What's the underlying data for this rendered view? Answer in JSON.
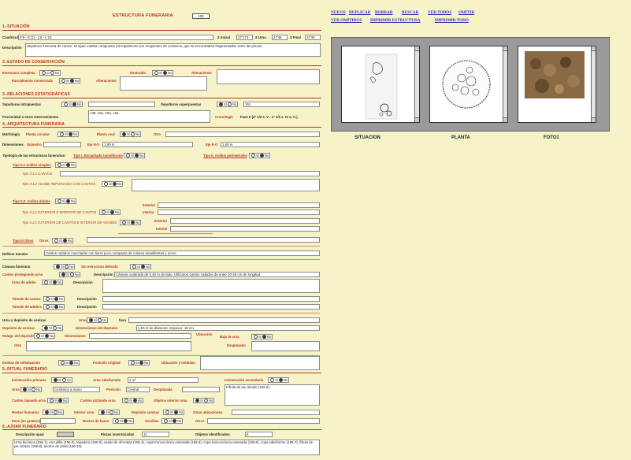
{
  "title": "ESTRUCTURA FUNERARIA",
  "record_id": "100",
  "links": [
    "NUEVO",
    "DUPLICAR",
    "BORRAR",
    "BUSCAR",
    "VER TODOS",
    "OMITIR",
    "VER OMITIDOS",
    "IMPRIMIR ESTRUCTURA",
    "IMPRIMIR TODO"
  ],
  "captions": {
    "situacion": "SITUACION",
    "planta": "PLANTA",
    "foto": "FOTO1"
  },
  "s1": {
    "head": "1.-SITUACIÓN",
    "cuadricula_l": "Cuadrícula",
    "cuadricula_v": "K'8 - K'10 - L'8 - L'10",
    "zi_l": "Z inicial",
    "zi_v": "27'173",
    "zu_l": "Z Urna",
    "zu_v": "27'49",
    "zf_l": "Z Final",
    "zf_v": "27'30",
    "desc_l": "Descripción",
    "desc_v": "Sepultura\nfuneraria de cantos. El ajuar estaba compuesto principalmente por recipientes de cerámica, que se encontraban fragmentados entre las piezas."
  },
  "s2": {
    "head": "2.-ESTADO DE CONSERVACIÓN",
    "ec_l": "Estructura completa",
    "des_l": "Destruida",
    "alt_l": "Alteraciones",
    "pc_l": "Parcialmente conservada",
    "alt2_l": "Alteraciones"
  },
  "s3": {
    "head": "3.-RELACIONES ESTATIGRÁFICAS",
    "si_l": "Sepulturas intrapuestas",
    "ss_l": "Sepulturas superpuestas",
    "ss_v": "151",
    "pe_l": "Proximidad a otros enterramientos",
    "pe_v": "149, 151, 152, 154.",
    "cr_l": "Cronología",
    "cr_v": "Fase II (2ª 1/2 s. V - 1ª 1/2 s. IV a. C.)"
  },
  "s4": {
    "head": "4.-ARQUITECTURA FUNERARIA",
    "morf_l": "Morfología",
    "pc_l": "Planta circular",
    "po_l": "Planta oval",
    "otro_l": "Otra",
    "dim_l": "Dimensiones",
    "diam_l": "Diámetro",
    "ejens_l": "Eje N-S",
    "ejens_v": "1,90 m",
    "ejeeo_l": "Eje E-O",
    "ejeeo_v": "1,65 m",
    "tip_l": "Tipología de las estructuras funerarias:",
    "t1_l": "Tipo I. Encachado tumuliforme",
    "t2_l": "Tipo II. Anillos perimetrales",
    "t21_l": "Tipo II.1 Anillos simples",
    "t211_l": "Tipo II.1.1 CANTOS",
    "t212_l": "Tipo II.1.2 ADOBE REFORZADO CON CANTOS",
    "t22_l": "Tipo II.2. Anillos dobles",
    "ext_l": "Exterior",
    "int_l": "Interior",
    "t221_l": "Tipo II.2.1 EXTERIOR E INTERIOR DE CANTOS",
    "t222_l": "Tipo II.2.1 EXTERIOR DE CANTOS E INTERIOR DE ADOBES",
    "t3_l": "Tipo III Otros",
    "otros_l": "Otros",
    "rt_l": "Relleno tumular",
    "rt_v": "Cantos rodados mezclados con tierra poco compacta de colores amarillentos y ocres.",
    "cf_l": "Cámara funeraria",
    "ed_l": "Sin estructura definida",
    "cp_l": "Cantos protegiendo urna",
    "cp_d_l": "Descripción",
    "cp_d_v": "Cámara cuadrada de 0,40 m de lado. Utilizaron cantos rodados de entre 20-25 cm de longitud.",
    "ca_l": "Cista de adobe",
    "ca_d_l": "Descripción",
    "tc_l": "Túmulo de cantos",
    "tc_d_l": "Descripción",
    "ta_l": "Túmulo de adobes",
    "ta_d_l": "Descripción",
    "ud_l": "Urna y depósito de cenizas",
    "urna_l": "Urna",
    "fosa_l": "fosa",
    "dc_l": "Depósito de cenizas",
    "dd_l": "Dimensiones del depósito",
    "dd_v": "1,50 m de diámetro. Espesor: 18 cm.",
    "rd_l": "Relugo del depósito",
    "dim2_l": "Dimensiones",
    "ub_l": "Ubicación",
    "bu_l": "Bajo la urna",
    "otro2_l": "Otro",
    "desp_l": "Desplazado",
    "es_l": "Estelas de señalización",
    "po2_l": "Posición original",
    "um_l": "Ubicación y medidas"
  },
  "s5": {
    "head": "5.-RITUAL FUNERARIO",
    "ip_l": "Incineración primaria",
    "ar_l": "Área rubefactada",
    "ar_v": "2 m²",
    "is_l": "Incineración secundaria",
    "urna_l": "Urna",
    "urna_v": "Cerámica a mano",
    "pos_l": "Posición",
    "pos_v": "Central",
    "desp_l": "Desplazada",
    "ajuar_v": "Fíbula de pie alzado (156.9).",
    "ct_l": "Cantos tapando urna",
    "cc_l": "Cantos calzando urna",
    "oi_l": "Objetos interior urna",
    "rh_l": "Restos humanos",
    "iu_l": "Interior urna",
    "dr_l": "Depósito cenizas",
    "ou_l": "Otras ubicaciones",
    "peso_l": "Peso (en gramos)",
    "rf_l": "Restos de fauna",
    "sem_l": "Semillas",
    "otros_l": "Otros"
  },
  "s6": {
    "head": "6.-AJUAR FUNERARIO",
    "da_l": "Descripción ajuar",
    "pi_l": "Piezas inventariadas",
    "pi_v": "11",
    "oi_l": "Objetos identificados",
    "oi_v": "8",
    "desc_v": "Urna bicónica (156.1), escudilla (156.2), tapadera (156.3), vasito de ofrendas (156.4), copa troncocónica carenada (156.5), copa troncocónica carenada (156.6), copa caliciforme (156.7), fíbula de pie alzado (156.8), anome de pinta (156.10)."
  },
  "opt": {
    "si": "Sí",
    "no": "No"
  }
}
